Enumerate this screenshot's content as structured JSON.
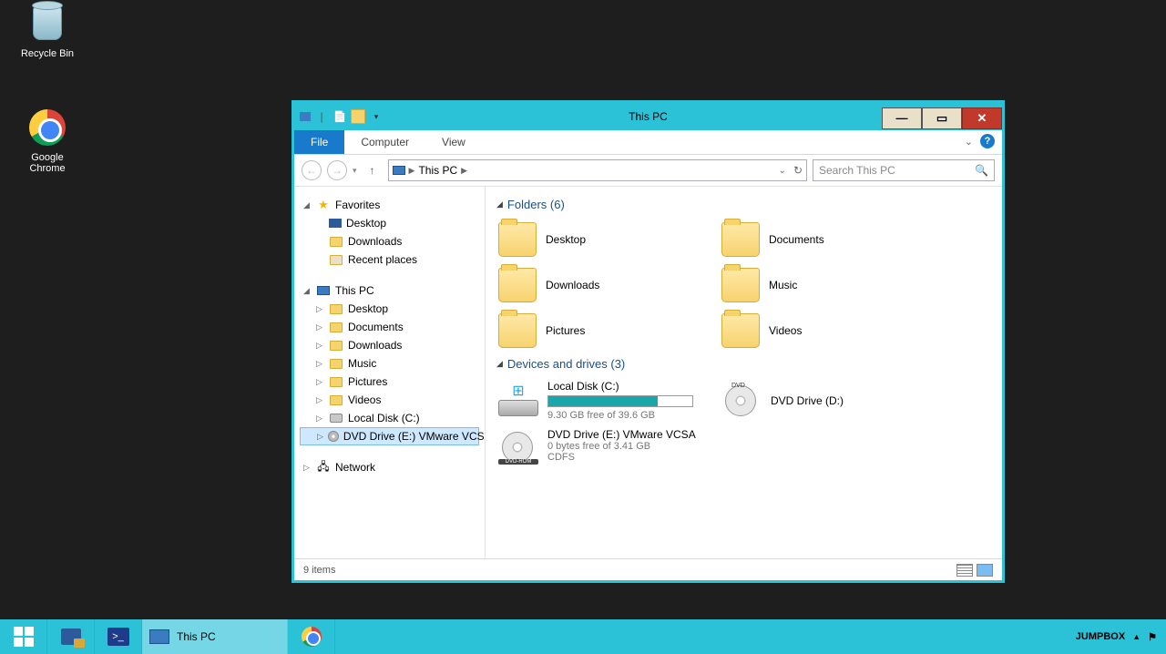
{
  "desktop": {
    "recycle_bin": "Recycle Bin",
    "chrome": "Google\nChrome"
  },
  "window": {
    "title": "This PC",
    "tabs": {
      "file": "File",
      "computer": "Computer",
      "view": "View"
    },
    "breadcrumb": "This PC",
    "search_placeholder": "Search This PC",
    "status": "9 items"
  },
  "tree": {
    "favorites": "Favorites",
    "fav_items": [
      "Desktop",
      "Downloads",
      "Recent places"
    ],
    "this_pc": "This PC",
    "pc_items": [
      "Desktop",
      "Documents",
      "Downloads",
      "Music",
      "Pictures",
      "Videos",
      "Local Disk (C:)",
      "DVD Drive (E:) VMware VCSA"
    ],
    "network": "Network"
  },
  "groups": {
    "folders": {
      "header": "Folders (6)",
      "items": [
        "Desktop",
        "Documents",
        "Downloads",
        "Music",
        "Pictures",
        "Videos"
      ]
    },
    "drives": {
      "header": "Devices and drives (3)",
      "c": {
        "name": "Local Disk (C:)",
        "sub": "9.30 GB free of 39.6 GB",
        "fill_pct": 76
      },
      "d": {
        "name": "DVD Drive (D:)"
      },
      "e": {
        "name": "DVD Drive (E:) VMware VCSA",
        "sub1": "0 bytes free of 3.41 GB",
        "sub2": "CDFS"
      }
    }
  },
  "taskbar": {
    "active": "This PC",
    "host": "JUMPBOX"
  }
}
